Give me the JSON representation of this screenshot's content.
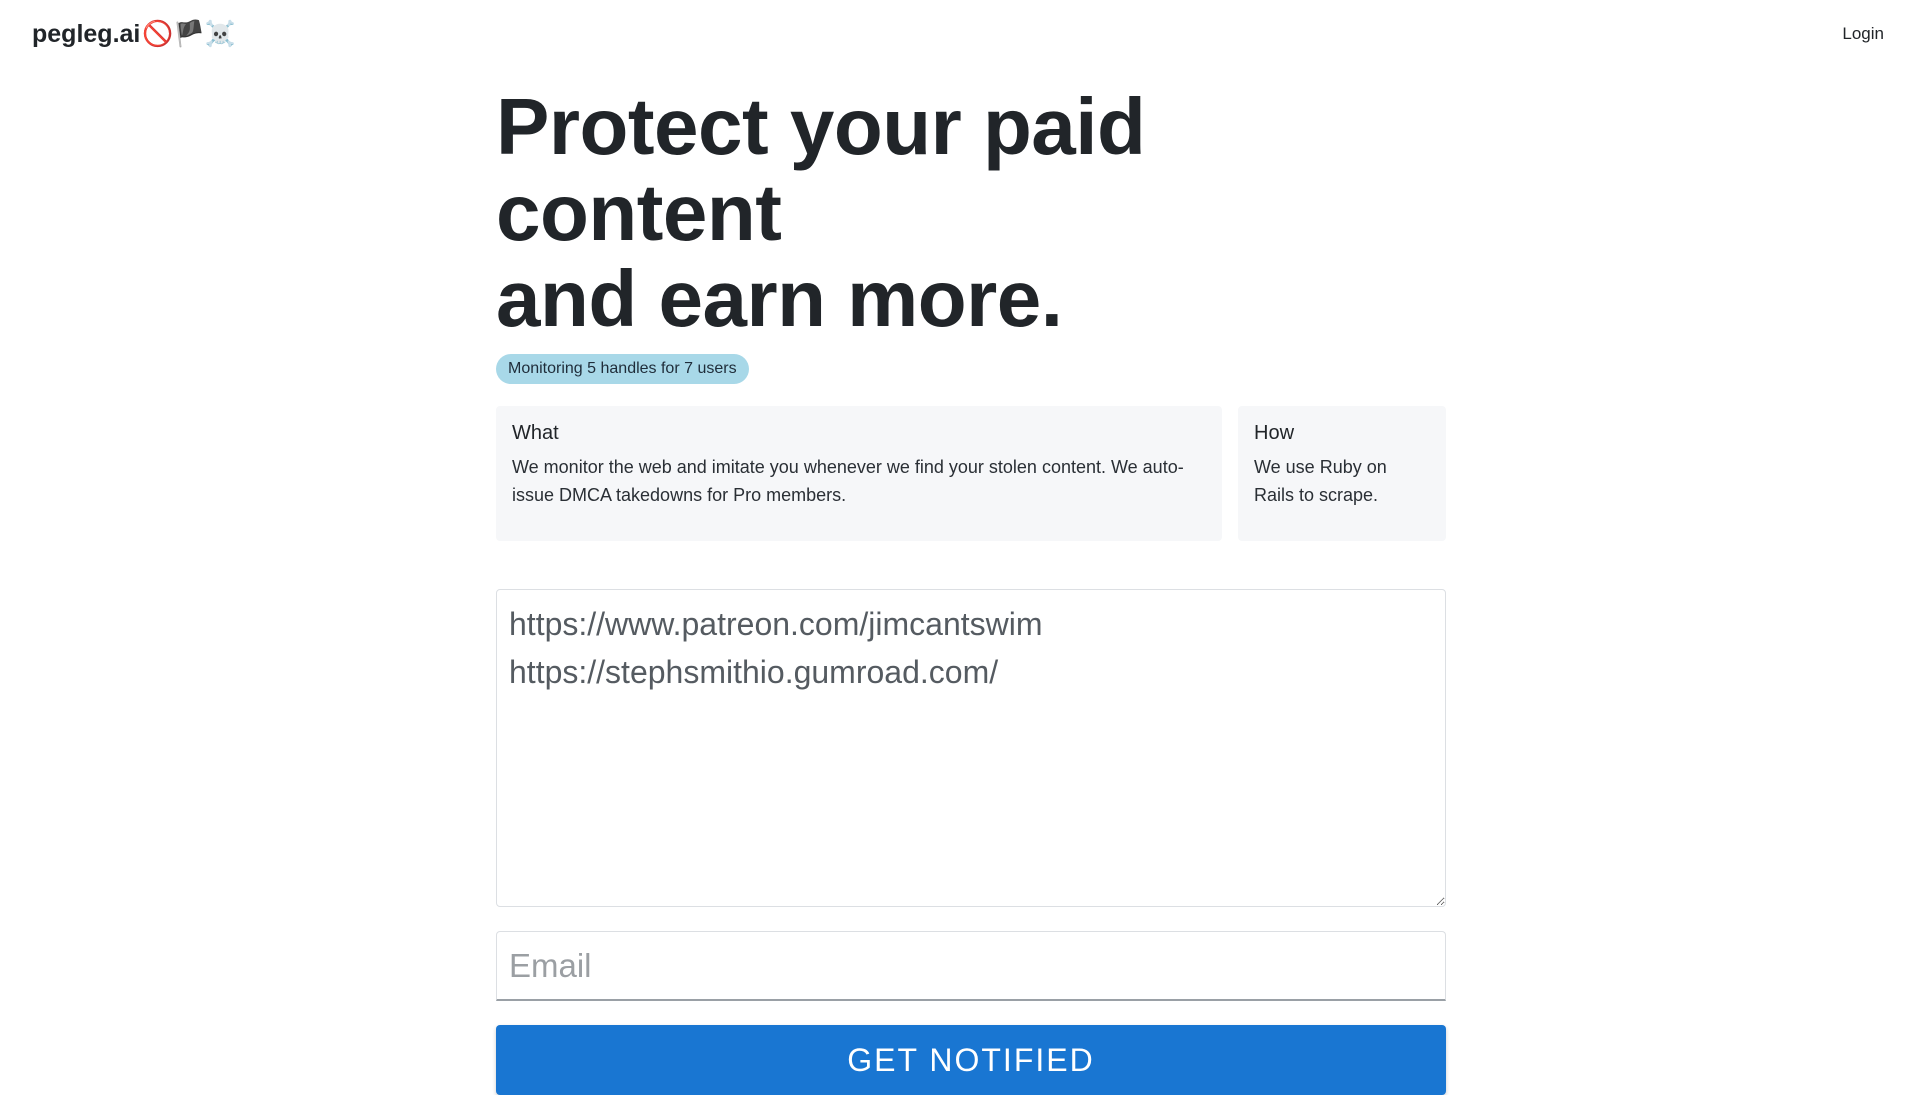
{
  "header": {
    "brand": "pegleg.ai",
    "brand_emoji": "🚫🏴☠️",
    "login_label": "Login"
  },
  "hero": {
    "title_line1": "Protect your paid content",
    "title_line2": "and earn more.",
    "badge": "Monitoring 5 handles for 7 users"
  },
  "cards": {
    "what": {
      "title": "What",
      "body": "We monitor the web and imitate you whenever we find your stolen content. We auto-issue DMCA takedowns for Pro members."
    },
    "how": {
      "title": "How",
      "body": "We use Ruby on Rails to scrape."
    }
  },
  "form": {
    "urls_value": "https://www.patreon.com/jimcantswim\nhttps://stephsmithio.gumroad.com/",
    "email_placeholder": "Email",
    "email_value": "",
    "submit_label": "GET NOTIFIED"
  },
  "colors": {
    "badge_bg": "#a8d8e8",
    "button_bg": "#1976d2",
    "card_bg": "#f6f7f9"
  }
}
